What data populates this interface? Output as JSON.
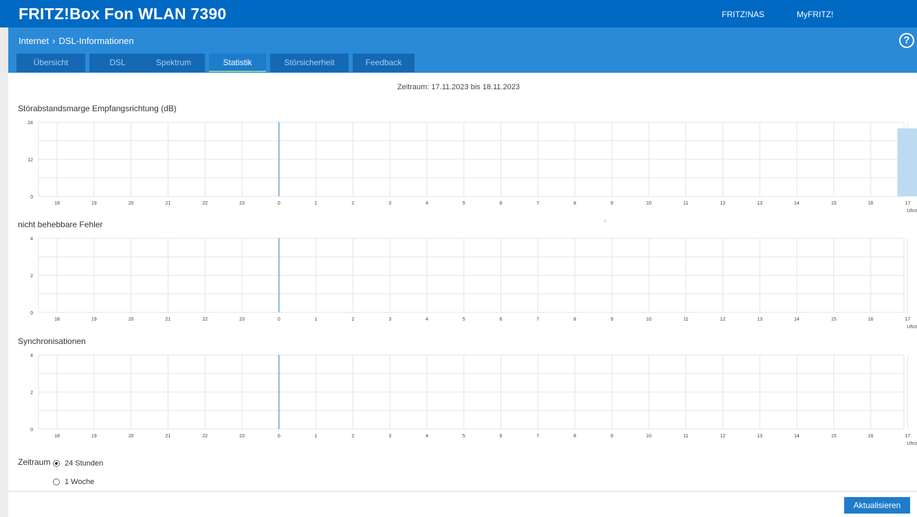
{
  "header": {
    "title": "FRITZ!Box Fon WLAN 7390",
    "links": [
      "FRITZ!NAS",
      "MyFRITZ!"
    ]
  },
  "breadcrumb": {
    "section": "Internet",
    "page": "DSL-Informationen",
    "help": "?"
  },
  "tabs": [
    "Übersicht",
    "DSL",
    "Spektrum",
    "Statistik",
    "Störsicherheit",
    "Feedback"
  ],
  "active_tab": "Statistik",
  "period_text": "Zeitraum: 17.11.2023 bis 18.11.2023",
  "x_unit": "Uhrzeit",
  "chart_data": [
    {
      "type": "bar",
      "title": "Störabstandsmarge Empfangsrichtung (dB)",
      "xlabel": "Uhrzeit",
      "categories": [
        "18",
        "19",
        "20",
        "21",
        "22",
        "23",
        "0",
        "1",
        "2",
        "3",
        "4",
        "5",
        "6",
        "7",
        "8",
        "9",
        "10",
        "11",
        "12",
        "13",
        "14",
        "15",
        "16",
        "17"
      ],
      "ylim": [
        0,
        24
      ],
      "yticks": [
        "0",
        "12",
        "24"
      ],
      "values": [
        null,
        null,
        null,
        null,
        null,
        null,
        null,
        null,
        null,
        null,
        null,
        null,
        null,
        null,
        null,
        null,
        null,
        null,
        null,
        null,
        null,
        null,
        null,
        22
      ],
      "day_marker": "0",
      "color": "#bcdaf0",
      "grid": true
    },
    {
      "type": "bar",
      "title": "nicht behebbare Fehler",
      "xlabel": "Uhrzeit",
      "categories": [
        "18",
        "19",
        "20",
        "21",
        "22",
        "23",
        "0",
        "1",
        "2",
        "3",
        "4",
        "5",
        "6",
        "7",
        "8",
        "9",
        "10",
        "11",
        "12",
        "13",
        "14",
        "15",
        "16",
        "17"
      ],
      "ylim": [
        0,
        4
      ],
      "yticks": [
        "0",
        "2",
        "4"
      ],
      "values": [],
      "day_marker": "0",
      "grid": true
    },
    {
      "type": "bar",
      "title": "Synchronisationen",
      "xlabel": "Uhrzeit",
      "categories": [
        "18",
        "19",
        "20",
        "21",
        "22",
        "23",
        "0",
        "1",
        "2",
        "3",
        "4",
        "5",
        "6",
        "7",
        "8",
        "9",
        "10",
        "11",
        "12",
        "13",
        "14",
        "15",
        "16",
        "17"
      ],
      "ylim": [
        0,
        4
      ],
      "yticks": [
        "0",
        "2",
        "4"
      ],
      "values": [],
      "day_marker": "0",
      "grid": true
    }
  ],
  "period_select": {
    "label": "Zeitraum",
    "options": [
      "24 Stunden",
      "1 Woche"
    ],
    "selected": "24 Stunden"
  },
  "refresh_button": "Aktualisieren",
  "colors": {
    "brand": "#0069c3",
    "sub": "#2a8ad8",
    "tab": "#1468b4",
    "tab_active": "#1e7ccc",
    "marker": "#1e7ccc"
  }
}
